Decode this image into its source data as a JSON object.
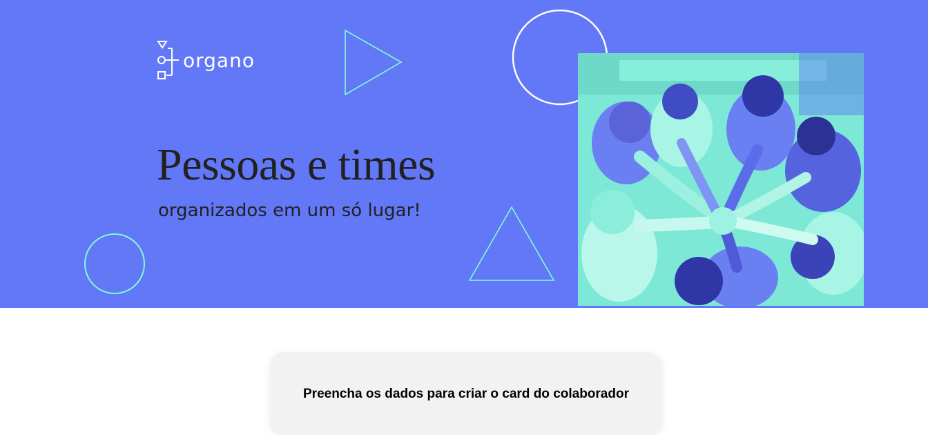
{
  "colors": {
    "banner_bg": "#6278F7",
    "accent_cyan": "#7FFFD4",
    "photo_tint": "#7EE8D6",
    "text_dark": "#212121",
    "form_bg": "#F2F2F2"
  },
  "header": {
    "logo_text": "organo",
    "logo_icon": "organo-org-chart-icon",
    "headline": "Pessoas e times",
    "subheadline": "organizados em um só lugar!",
    "photo_alt": "team-hands-together-photo"
  },
  "form": {
    "title": "Preencha os dados para criar o card do colaborador"
  }
}
